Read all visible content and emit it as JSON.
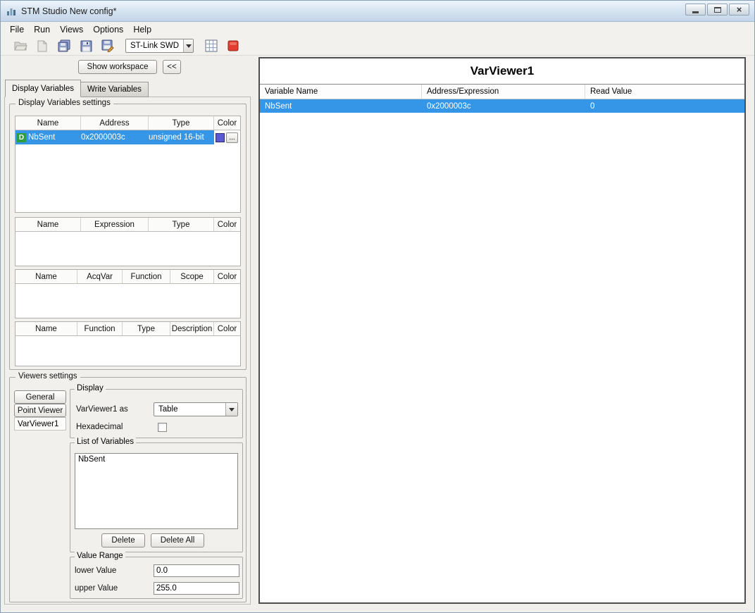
{
  "window": {
    "title": "STM Studio New config*"
  },
  "colors": {
    "selection": "#3596e8"
  },
  "menu": {
    "items": [
      {
        "label": "File"
      },
      {
        "label": "Run"
      },
      {
        "label": "Views"
      },
      {
        "label": "Options"
      },
      {
        "label": "Help"
      }
    ]
  },
  "toolbar": {
    "probe_value": "ST-Link SWD",
    "icons": [
      "open-folder-icon",
      "new-document-icon",
      "save-all-icon",
      "save-icon",
      "save-as-icon",
      "table-grid-icon",
      "record-stop-icon"
    ]
  },
  "workspace_bar": {
    "show_workspace": "Show workspace",
    "collapse": "<<"
  },
  "tabs": [
    {
      "label": "Display Variables"
    },
    {
      "label": "Write Variables"
    }
  ],
  "display_settings": {
    "title": "Display Variables settings",
    "address_table": {
      "headers": [
        "Name",
        "Address",
        "Type",
        "Color"
      ],
      "rows": [
        {
          "badge": "D",
          "name": "NbSent",
          "address": "0x2000003c",
          "type": "unsigned 16-bit",
          "color": "#5a5ad2",
          "more": "..."
        }
      ]
    },
    "expression_table": {
      "headers": [
        "Name",
        "Expression",
        "Type",
        "Color"
      ],
      "rows": []
    },
    "acq_table": {
      "headers": [
        "Name",
        "AcqVar",
        "Function",
        "Scope",
        "Color"
      ],
      "rows": []
    },
    "function_table": {
      "headers": [
        "Name",
        "Function",
        "Type",
        "Description",
        "Color"
      ],
      "rows": []
    }
  },
  "viewers": {
    "title": "Viewers settings",
    "viewer_list": [
      {
        "label": "General"
      },
      {
        "label": "Point Viewer"
      },
      {
        "label": "VarViewer1"
      }
    ],
    "display_group": {
      "title": "Display",
      "as_label": "VarViewer1 as",
      "as_value": "Table",
      "hex_label": "Hexadecimal"
    },
    "variables_group": {
      "title": "List of Variables",
      "items": [
        {
          "name": "NbSent"
        }
      ],
      "delete": "Delete",
      "delete_all": "Delete All"
    },
    "value_range": {
      "title": "Value Range",
      "lower_label": "lower Value",
      "lower_value": "0.0",
      "upper_label": "upper Value",
      "upper_value": "255.0"
    }
  },
  "var_viewer": {
    "title": "VarViewer1",
    "headers": [
      "Variable Name",
      "Address/Expression",
      "Read Value"
    ],
    "rows": [
      {
        "name": "NbSent",
        "address": "0x2000003c",
        "value": "0"
      }
    ]
  }
}
